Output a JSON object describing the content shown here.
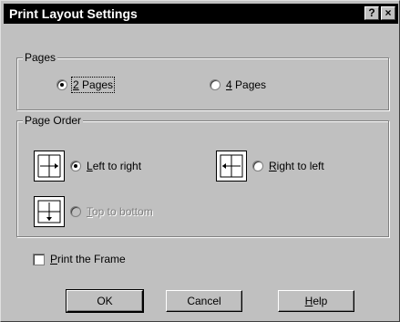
{
  "dialog": {
    "title": "Print Layout Settings",
    "help_btn": "?",
    "close_btn": "×"
  },
  "pages_group": {
    "legend": "Pages",
    "options": [
      {
        "label": "2 Pages",
        "selected": true
      },
      {
        "label": "4 Pages",
        "selected": false
      }
    ]
  },
  "order_group": {
    "legend": "Page Order",
    "options": [
      {
        "label": "Left to right",
        "selected": true,
        "enabled": true,
        "icon": "arrow-left-to-right-icon"
      },
      {
        "label": "Right to left",
        "selected": false,
        "enabled": true,
        "icon": "arrow-right-to-left-icon"
      },
      {
        "label": "Top to bottom",
        "selected": false,
        "enabled": false,
        "icon": "arrow-top-to-bottom-icon"
      }
    ]
  },
  "frame": {
    "label": "Print the Frame",
    "checked": false
  },
  "buttons": {
    "ok": "OK",
    "cancel": "Cancel",
    "help": "Help"
  }
}
